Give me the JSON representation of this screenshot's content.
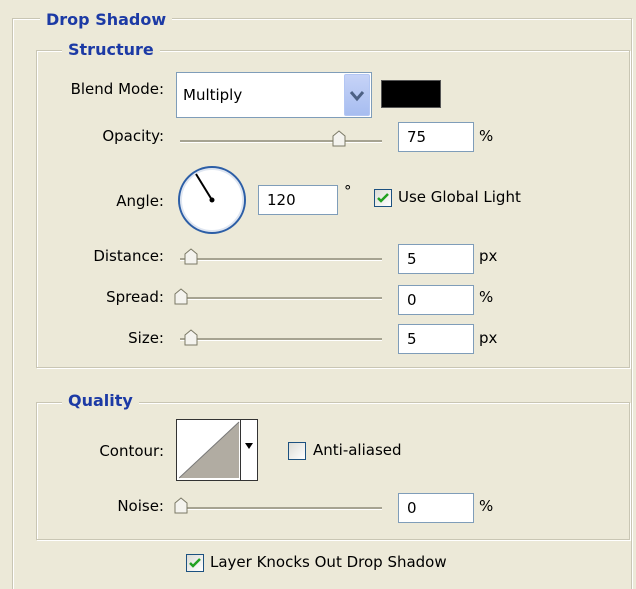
{
  "drop_shadow": {
    "title": "Drop Shadow"
  },
  "structure": {
    "title": "Structure",
    "blend_mode": {
      "label": "Blend Mode:",
      "value": "Multiply",
      "color": "#000000"
    },
    "opacity": {
      "label": "Opacity:",
      "value": "75",
      "unit": "%",
      "level": 0.75
    },
    "angle": {
      "label": "Angle:",
      "value": "120",
      "unit": "°",
      "use_global_light_label": "Use Global Light",
      "use_global_light_checked": true
    },
    "distance": {
      "label": "Distance:",
      "value": "5",
      "unit": "px",
      "level": 0.02
    },
    "spread": {
      "label": "Spread:",
      "value": "0",
      "unit": "%",
      "level": 0.0
    },
    "size": {
      "label": "Size:",
      "value": "5",
      "unit": "px",
      "level": 0.02
    }
  },
  "quality": {
    "title": "Quality",
    "contour": {
      "label": "Contour:"
    },
    "anti_aliased": {
      "label": "Anti-aliased",
      "checked": false
    },
    "noise": {
      "label": "Noise:",
      "value": "0",
      "unit": "%",
      "level": 0.0
    }
  },
  "layer_knocks_out": {
    "label": "Layer Knocks Out Drop Shadow",
    "checked": true
  },
  "colors": {
    "legend": "#1c3aa5",
    "background": "#ece9d8",
    "border": "#7f9db9"
  }
}
